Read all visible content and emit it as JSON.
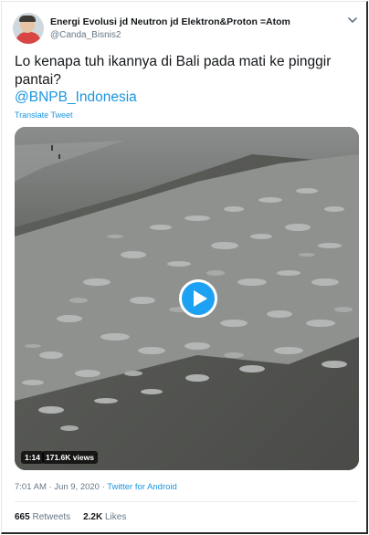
{
  "tweet": {
    "author_name": "Energi Evolusi jd Neutron jd Elektron&Proton =Atom",
    "author_handle": "@Canda_Bisnis2",
    "text": "Lo kenapa tuh ikannya di Bali pada mati ke pinggir pantai?",
    "mention": "@BNPB_Indonesia",
    "translate_label": "Translate Tweet",
    "video": {
      "duration": "1:14",
      "views": "171.6K views"
    },
    "time": "7:01 AM",
    "date": "Jun 9, 2020",
    "separator": "·",
    "source": "Twitter for Android",
    "retweets_count": "665",
    "retweets_label": "Retweets",
    "likes_count": "2.2K",
    "likes_label": "Likes"
  },
  "colors": {
    "accent": "#1b95e0",
    "play_button": "#1da1f2",
    "muted_text": "#657786"
  },
  "icons": [
    "avatar",
    "chevron-down-icon",
    "play-icon"
  ]
}
